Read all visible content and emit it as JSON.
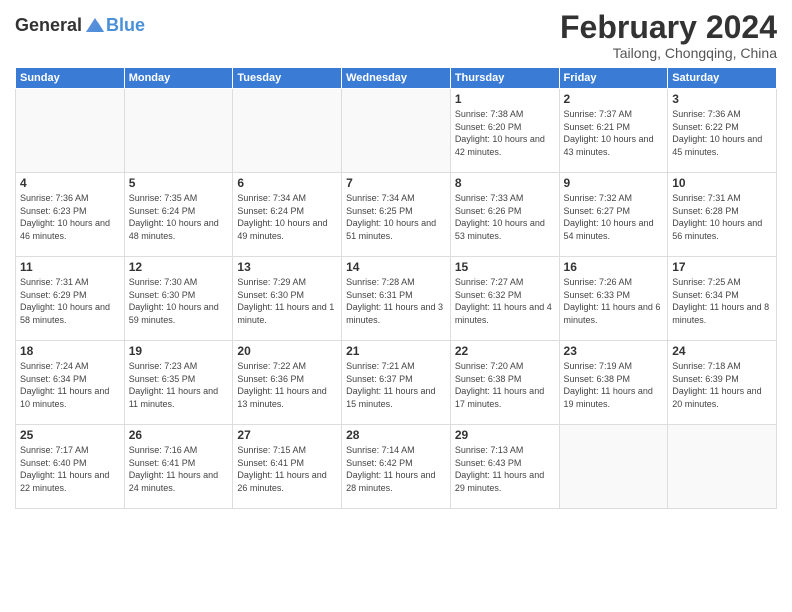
{
  "header": {
    "logo_general": "General",
    "logo_blue": "Blue",
    "title": "February 2024",
    "subtitle": "Tailong, Chongqing, China"
  },
  "weekdays": [
    "Sunday",
    "Monday",
    "Tuesday",
    "Wednesday",
    "Thursday",
    "Friday",
    "Saturday"
  ],
  "weeks": [
    [
      {
        "day": "",
        "info": ""
      },
      {
        "day": "",
        "info": ""
      },
      {
        "day": "",
        "info": ""
      },
      {
        "day": "",
        "info": ""
      },
      {
        "day": "1",
        "info": "Sunrise: 7:38 AM\nSunset: 6:20 PM\nDaylight: 10 hours\nand 42 minutes."
      },
      {
        "day": "2",
        "info": "Sunrise: 7:37 AM\nSunset: 6:21 PM\nDaylight: 10 hours\nand 43 minutes."
      },
      {
        "day": "3",
        "info": "Sunrise: 7:36 AM\nSunset: 6:22 PM\nDaylight: 10 hours\nand 45 minutes."
      }
    ],
    [
      {
        "day": "4",
        "info": "Sunrise: 7:36 AM\nSunset: 6:23 PM\nDaylight: 10 hours\nand 46 minutes."
      },
      {
        "day": "5",
        "info": "Sunrise: 7:35 AM\nSunset: 6:24 PM\nDaylight: 10 hours\nand 48 minutes."
      },
      {
        "day": "6",
        "info": "Sunrise: 7:34 AM\nSunset: 6:24 PM\nDaylight: 10 hours\nand 49 minutes."
      },
      {
        "day": "7",
        "info": "Sunrise: 7:34 AM\nSunset: 6:25 PM\nDaylight: 10 hours\nand 51 minutes."
      },
      {
        "day": "8",
        "info": "Sunrise: 7:33 AM\nSunset: 6:26 PM\nDaylight: 10 hours\nand 53 minutes."
      },
      {
        "day": "9",
        "info": "Sunrise: 7:32 AM\nSunset: 6:27 PM\nDaylight: 10 hours\nand 54 minutes."
      },
      {
        "day": "10",
        "info": "Sunrise: 7:31 AM\nSunset: 6:28 PM\nDaylight: 10 hours\nand 56 minutes."
      }
    ],
    [
      {
        "day": "11",
        "info": "Sunrise: 7:31 AM\nSunset: 6:29 PM\nDaylight: 10 hours\nand 58 minutes."
      },
      {
        "day": "12",
        "info": "Sunrise: 7:30 AM\nSunset: 6:30 PM\nDaylight: 10 hours\nand 59 minutes."
      },
      {
        "day": "13",
        "info": "Sunrise: 7:29 AM\nSunset: 6:30 PM\nDaylight: 11 hours\nand 1 minute."
      },
      {
        "day": "14",
        "info": "Sunrise: 7:28 AM\nSunset: 6:31 PM\nDaylight: 11 hours\nand 3 minutes."
      },
      {
        "day": "15",
        "info": "Sunrise: 7:27 AM\nSunset: 6:32 PM\nDaylight: 11 hours\nand 4 minutes."
      },
      {
        "day": "16",
        "info": "Sunrise: 7:26 AM\nSunset: 6:33 PM\nDaylight: 11 hours\nand 6 minutes."
      },
      {
        "day": "17",
        "info": "Sunrise: 7:25 AM\nSunset: 6:34 PM\nDaylight: 11 hours\nand 8 minutes."
      }
    ],
    [
      {
        "day": "18",
        "info": "Sunrise: 7:24 AM\nSunset: 6:34 PM\nDaylight: 11 hours\nand 10 minutes."
      },
      {
        "day": "19",
        "info": "Sunrise: 7:23 AM\nSunset: 6:35 PM\nDaylight: 11 hours\nand 11 minutes."
      },
      {
        "day": "20",
        "info": "Sunrise: 7:22 AM\nSunset: 6:36 PM\nDaylight: 11 hours\nand 13 minutes."
      },
      {
        "day": "21",
        "info": "Sunrise: 7:21 AM\nSunset: 6:37 PM\nDaylight: 11 hours\nand 15 minutes."
      },
      {
        "day": "22",
        "info": "Sunrise: 7:20 AM\nSunset: 6:38 PM\nDaylight: 11 hours\nand 17 minutes."
      },
      {
        "day": "23",
        "info": "Sunrise: 7:19 AM\nSunset: 6:38 PM\nDaylight: 11 hours\nand 19 minutes."
      },
      {
        "day": "24",
        "info": "Sunrise: 7:18 AM\nSunset: 6:39 PM\nDaylight: 11 hours\nand 20 minutes."
      }
    ],
    [
      {
        "day": "25",
        "info": "Sunrise: 7:17 AM\nSunset: 6:40 PM\nDaylight: 11 hours\nand 22 minutes."
      },
      {
        "day": "26",
        "info": "Sunrise: 7:16 AM\nSunset: 6:41 PM\nDaylight: 11 hours\nand 24 minutes."
      },
      {
        "day": "27",
        "info": "Sunrise: 7:15 AM\nSunset: 6:41 PM\nDaylight: 11 hours\nand 26 minutes."
      },
      {
        "day": "28",
        "info": "Sunrise: 7:14 AM\nSunset: 6:42 PM\nDaylight: 11 hours\nand 28 minutes."
      },
      {
        "day": "29",
        "info": "Sunrise: 7:13 AM\nSunset: 6:43 PM\nDaylight: 11 hours\nand 29 minutes."
      },
      {
        "day": "",
        "info": ""
      },
      {
        "day": "",
        "info": ""
      }
    ]
  ]
}
